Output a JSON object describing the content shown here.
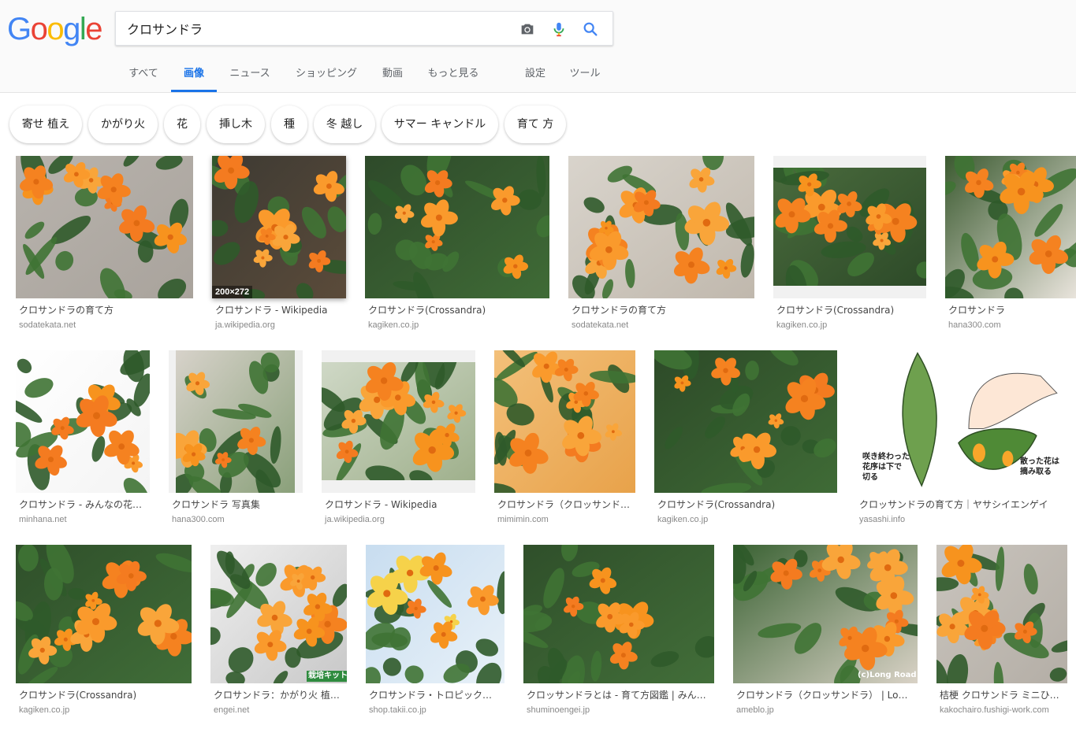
{
  "logo": {
    "text": "Google"
  },
  "search": {
    "query": "クロサンドラ"
  },
  "search_icons": [
    "camera-icon",
    "mic-icon",
    "search-icon"
  ],
  "tabs": [
    {
      "label": "すべて",
      "active": false
    },
    {
      "label": "画像",
      "active": true
    },
    {
      "label": "ニュース",
      "active": false
    },
    {
      "label": "ショッピング",
      "active": false
    },
    {
      "label": "動画",
      "active": false
    },
    {
      "label": "もっと見る",
      "active": false
    },
    {
      "label": "設定",
      "active": false
    },
    {
      "label": "ツール",
      "active": false
    }
  ],
  "chips": [
    "寄せ 植え",
    "かがり火",
    "花",
    "挿し木",
    "種",
    "冬 越し",
    "サマー キャンドル",
    "育て 方"
  ],
  "results": [
    {
      "title": "クロサンドラの育て方",
      "host": "sodatekata.net"
    },
    {
      "title": "クロサンドラ - Wikipedia",
      "host": "ja.wikipedia.org",
      "badge": "200×272"
    },
    {
      "title": "クロサンドラ(Crossandra)",
      "host": "kagiken.co.jp"
    },
    {
      "title": "クロサンドラの育て方",
      "host": "sodatekata.net"
    },
    {
      "title": "クロサンドラ(Crossandra)",
      "host": "kagiken.co.jp"
    },
    {
      "title": "クロサンドラ",
      "host": "hana300.com"
    },
    {
      "title": "クロサンドラ - みんなの花…",
      "host": "minhana.net"
    },
    {
      "title": "クロサンドラ 写真集",
      "host": "hana300.com"
    },
    {
      "title": "クロサンドラ - Wikipedia",
      "host": "ja.wikipedia.org"
    },
    {
      "title": "クロサンドラ（クロッサンド…",
      "host": "mimimin.com"
    },
    {
      "title": "クロサンドラ(Crossandra)",
      "host": "kagiken.co.jp"
    },
    {
      "title": "クロッサンドラの育て方｜ヤサシイエンゲイ",
      "host": "yasashi.info",
      "image_text": [
        "咲き終わった",
        "花序は下で",
        "切る",
        "散った花は",
        "摘み取る"
      ]
    },
    {
      "title": "クロサンドラ(Crossandra)",
      "host": "kagiken.co.jp"
    },
    {
      "title": "クロサンドラ：かがり火 植…",
      "host": "engei.net",
      "image_text": [
        "栽培キット"
      ]
    },
    {
      "title": "クロサンドラ・トロピック…",
      "host": "shop.takii.co.jp"
    },
    {
      "title": "クロッサンドラとは - 育て方図鑑 | みん…",
      "host": "shuminoengei.jp"
    },
    {
      "title": "クロサンドラ（クロッサンドラ） | Lo…",
      "host": "ameblo.jp",
      "image_text": [
        "(c)Long Road"
      ]
    },
    {
      "title": "桔梗 クロサンドラ ミニひ…",
      "host": "kakochairo.fushigi-work.com"
    }
  ],
  "colors": {
    "accent": "#1a73e8",
    "flower": "#f58a1f",
    "leaf": "#2f5a2a"
  }
}
